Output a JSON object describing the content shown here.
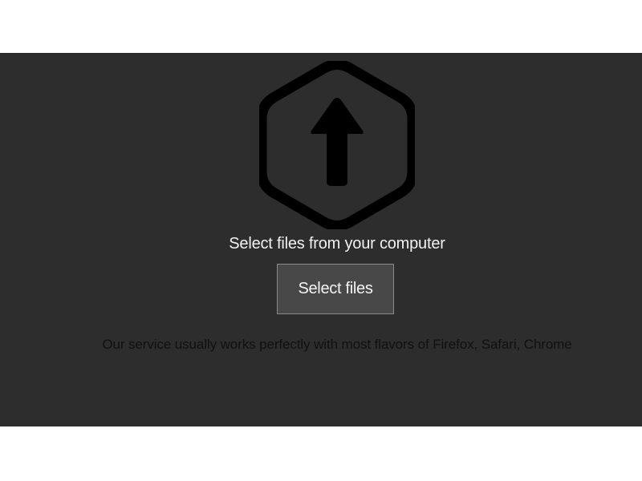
{
  "upload_panel": {
    "icon": "hexagon-upload-arrow-icon",
    "prompt": "Select files from your computer",
    "select_button_label": "Select files",
    "browser_note": "Our service usually works perfectly with most flavors of Firefox, Safari, Chrome"
  },
  "colors": {
    "panel_background": "#2d2d2d",
    "page_background": "#ffffff",
    "icon": "#000000",
    "button_background": "#484848",
    "button_border": "#8a8a8a",
    "prompt_text": "#f2f2f2",
    "note_text": "#111111"
  }
}
